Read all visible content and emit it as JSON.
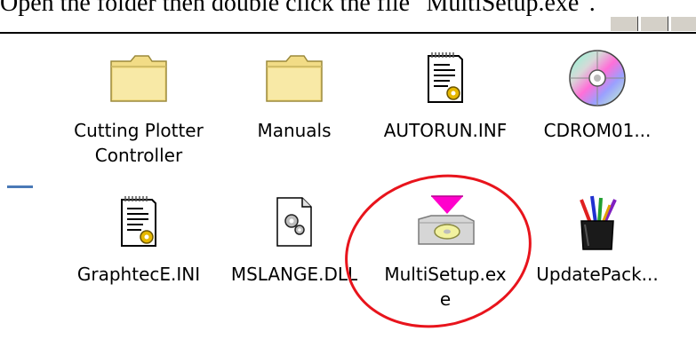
{
  "instruction_text": "Open the folder then double click the file \"MultiSetup.exe\".",
  "files": [
    {
      "name": "Cutting Plotter Controller",
      "icon": "folder-icon"
    },
    {
      "name": "Manuals",
      "icon": "folder-icon"
    },
    {
      "name": "AUTORUN.INF",
      "icon": "settings-file-icon"
    },
    {
      "name": "CDROM01...",
      "icon": "cd-icon"
    },
    {
      "name": "GraphtecE.INI",
      "icon": "settings-file-icon"
    },
    {
      "name": "MSLANGE.DLL",
      "icon": "dll-file-icon"
    },
    {
      "name": "MultiSetup.exe",
      "icon": "setup-icon"
    },
    {
      "name": "UpdatePack...",
      "icon": "pencil-cup-icon"
    }
  ],
  "colors": {
    "highlight": "#e8141c",
    "folder": "#f2dc86",
    "accent": "#4a79b6",
    "setup_arrow": "#ff00cc"
  }
}
